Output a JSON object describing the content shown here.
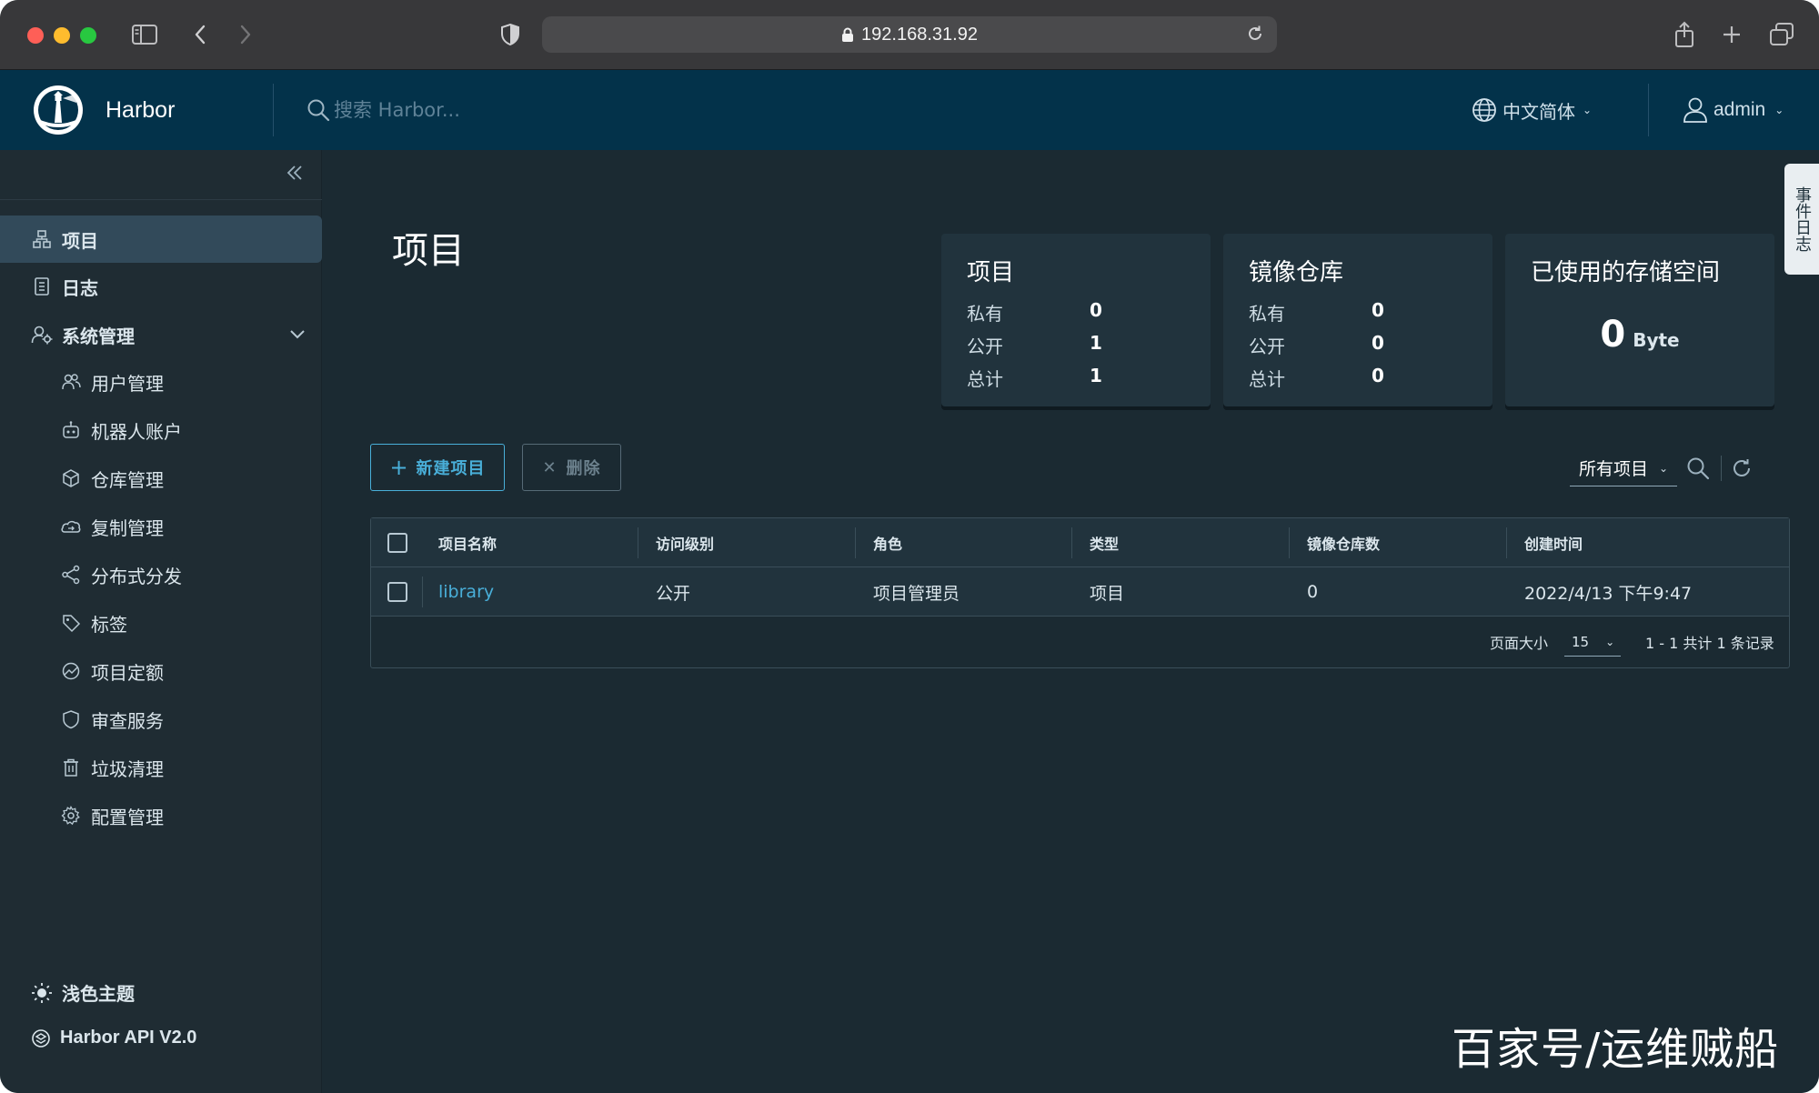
{
  "browser": {
    "url": "192.168.31.92",
    "icons": [
      "sidebar-toggle-icon",
      "back-icon",
      "forward-icon",
      "shield-icon",
      "lock-icon",
      "reload-icon",
      "share-icon",
      "new-tab-icon",
      "tabs-overview-icon"
    ]
  },
  "header": {
    "brand": "Harbor",
    "search_placeholder": "搜索 Harbor...",
    "language": "中文简体",
    "user": "admin"
  },
  "sidebar": {
    "items": [
      {
        "label": "项目",
        "icon": "projects-icon",
        "active": true
      },
      {
        "label": "日志",
        "icon": "log-icon"
      },
      {
        "label": "系统管理",
        "icon": "admin-icon",
        "expanded": true
      },
      {
        "label": "用户管理",
        "icon": "users-icon"
      },
      {
        "label": "机器人账户",
        "icon": "robot-icon"
      },
      {
        "label": "仓库管理",
        "icon": "registry-icon"
      },
      {
        "label": "复制管理",
        "icon": "replication-icon"
      },
      {
        "label": "分布式分发",
        "icon": "distribution-icon"
      },
      {
        "label": "标签",
        "icon": "tag-icon"
      },
      {
        "label": "项目定额",
        "icon": "quota-icon"
      },
      {
        "label": "审查服务",
        "icon": "interrogation-icon"
      },
      {
        "label": "垃圾清理",
        "icon": "trash-icon"
      },
      {
        "label": "配置管理",
        "icon": "settings-icon"
      }
    ],
    "theme_label": "浅色主题",
    "api_label": "Harbor API V2.0"
  },
  "main": {
    "title": "项目",
    "cards": {
      "projects": {
        "title": "项目",
        "private_label": "私有",
        "private": "0",
        "public_label": "公开",
        "public": "1",
        "total_label": "总计",
        "total": "1"
      },
      "repos": {
        "title": "镜像仓库",
        "private_label": "私有",
        "private": "0",
        "public_label": "公开",
        "public": "0",
        "total_label": "总计",
        "total": "0"
      },
      "storage": {
        "title": "已使用的存储空间",
        "value": "0",
        "unit": "Byte"
      }
    },
    "event_log_tab": "事件日志",
    "new_project_label": "新建项目",
    "delete_label": "删除",
    "filter_value": "所有项目",
    "table": {
      "columns": [
        "项目名称",
        "访问级别",
        "角色",
        "类型",
        "镜像仓库数",
        "创建时间"
      ],
      "rows": [
        {
          "name": "library",
          "access": "公开",
          "role": "项目管理员",
          "type": "项目",
          "repo_count": "0",
          "created": "2022/4/13 下午9:47"
        }
      ],
      "page_size_label": "页面大小",
      "page_size": "15",
      "page_info": "1 - 1 共计 1 条记录"
    }
  },
  "watermark": "百家号/运维贼船"
}
